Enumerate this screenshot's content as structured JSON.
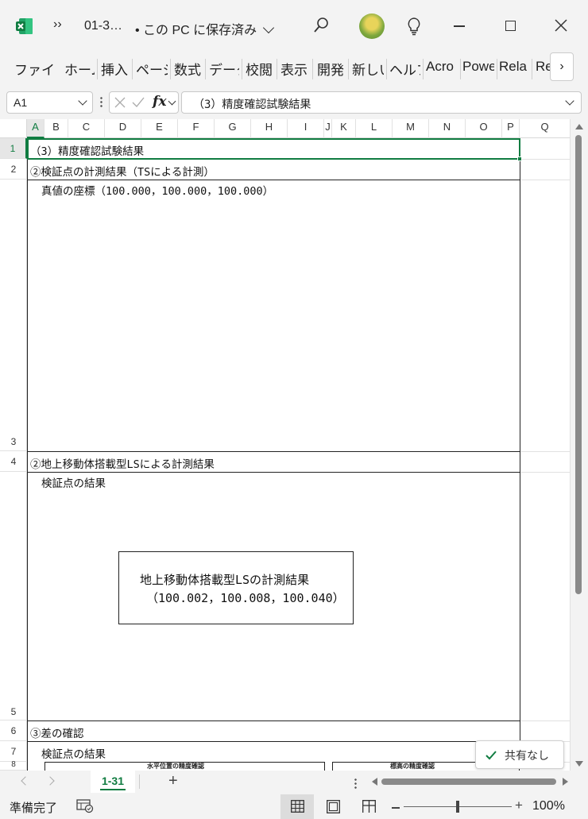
{
  "app": {
    "file_name": "01-3…",
    "save_status": "• この PC に保存済み",
    "overflow_glyph": "››",
    "brand_color": "#107c41"
  },
  "ribbon": {
    "tabs": [
      "ファイル",
      "ホーム",
      "挿入",
      "ページ",
      "数式",
      "データ",
      "校閲",
      "表示",
      "開発",
      "新しい",
      "ヘルプ",
      "Acro",
      "Powe",
      "Rela",
      "Re"
    ],
    "more_glyph": "›"
  },
  "formula_bar": {
    "name_box": "A1",
    "fx_label": "fx",
    "content": "（3）精度確認試験結果"
  },
  "grid": {
    "columns": [
      "A",
      "B",
      "C",
      "D",
      "E",
      "F",
      "G",
      "H",
      "I",
      "J",
      "K",
      "L",
      "M",
      "N",
      "O",
      "P",
      "Q"
    ],
    "rows": [
      "1",
      "2",
      "3",
      "4",
      "5",
      "6",
      "7",
      "8"
    ],
    "cells": {
      "r1": "（3）精度確認試験結果",
      "r2": "②検証点の計測結果（TSによる計測）",
      "r2_sub": "真値の座標（100.000，100.000，100.000）",
      "r4": "②地上移動体搭載型LSによる計測結果",
      "r4_sub": "検証点の結果",
      "box_line1": "地上移動体搭載型LSの計測結果",
      "box_line2": "（100.002，100.008，100.040）",
      "r6": "③差の確認",
      "r7": "検証点の結果",
      "r8_left": "水平位置の精度確認",
      "r8_right": "標高の精度確認"
    }
  },
  "share_badge": {
    "label": "共有なし"
  },
  "sheet_tabs": {
    "active": "1-31",
    "add_glyph": "+"
  },
  "status_bar": {
    "ready": "準備完了",
    "zoom": "100%",
    "zoom_fraction": 0.5
  }
}
